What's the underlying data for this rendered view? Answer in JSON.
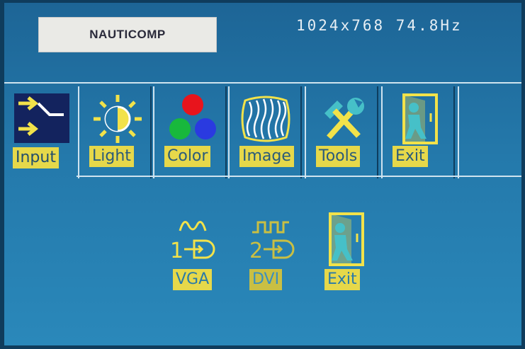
{
  "header": {
    "logo_text": "NAUTICOMP",
    "resolution": "1024x768 74.8Hz"
  },
  "tabs": [
    {
      "id": "input",
      "label": "Input",
      "icon": "input-arrows-icon",
      "active": true
    },
    {
      "id": "light",
      "label": "Light",
      "icon": "sun-brightness-icon",
      "active": false
    },
    {
      "id": "color",
      "label": "Color",
      "icon": "rgb-circles-icon",
      "active": false
    },
    {
      "id": "image",
      "label": "Image",
      "icon": "wave-image-icon",
      "active": false
    },
    {
      "id": "tools",
      "label": "Tools",
      "icon": "hammer-wrench-icon",
      "active": false
    },
    {
      "id": "exit",
      "label": "Exit",
      "icon": "exit-door-icon",
      "active": false
    }
  ],
  "submenu": [
    {
      "id": "vga",
      "label": "VGA",
      "number": "1",
      "icon": "analog-vga-icon"
    },
    {
      "id": "dvi",
      "label": "DVI",
      "number": "2",
      "icon": "digital-dvi-icon"
    },
    {
      "id": "exit",
      "label": "Exit",
      "icon": "exit-door-icon"
    }
  ],
  "colors": {
    "background": "#2479ab",
    "label_bg": "#e6d84a",
    "active_tab_icon_bg": "#13235e"
  }
}
